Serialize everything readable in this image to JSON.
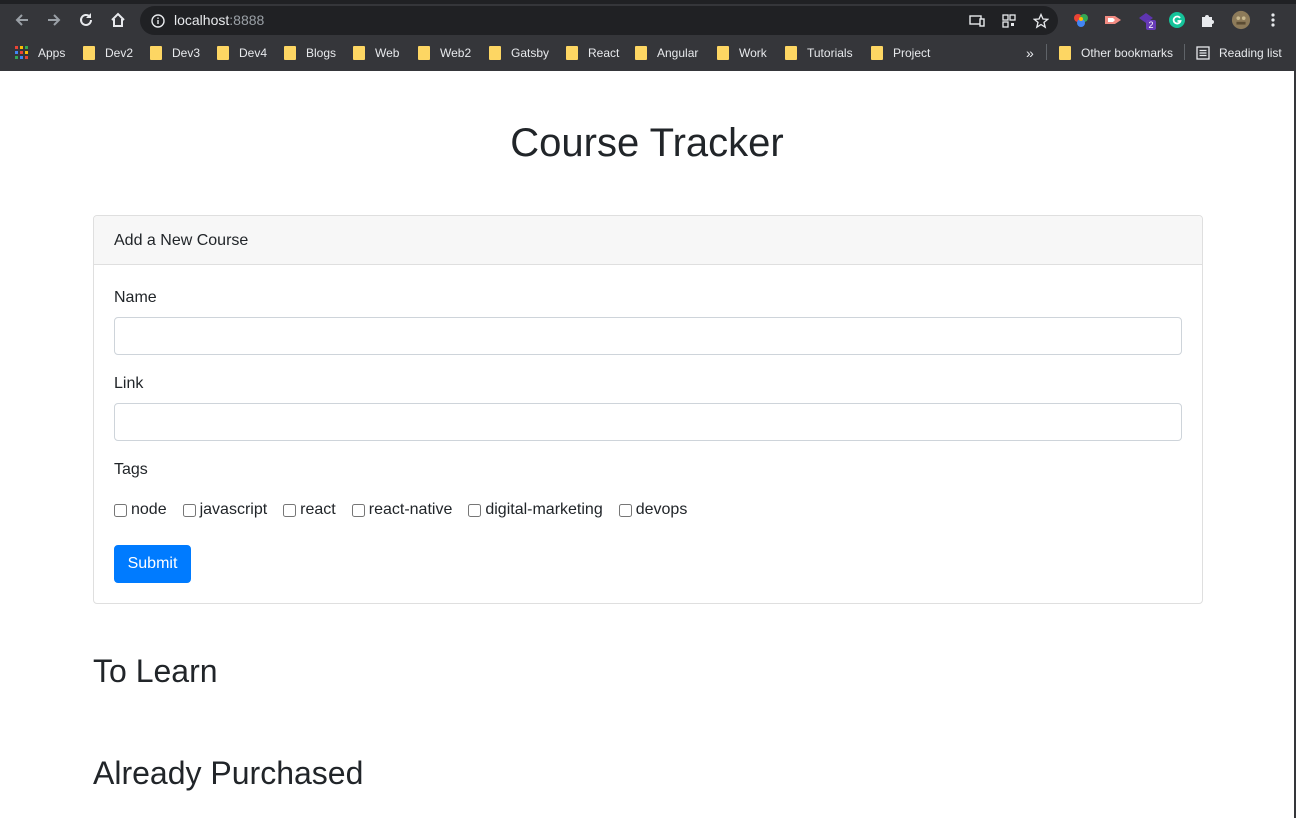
{
  "browser": {
    "url_host": "localhost",
    "url_port": ":8888",
    "extension_badge": "2",
    "bookmarks": [
      {
        "label": "Apps"
      },
      {
        "label": "Dev2"
      },
      {
        "label": "Dev3"
      },
      {
        "label": "Dev4"
      },
      {
        "label": "Blogs"
      },
      {
        "label": "Web"
      },
      {
        "label": "Web2"
      },
      {
        "label": "Gatsby"
      },
      {
        "label": "React"
      },
      {
        "label": "Angular"
      },
      {
        "label": "Work"
      },
      {
        "label": "Tutorials"
      },
      {
        "label": "Project"
      }
    ],
    "overflow_label": "»",
    "other_bookmarks": "Other bookmarks",
    "reading_list": "Reading list"
  },
  "page": {
    "title": "Course Tracker",
    "card": {
      "header": "Add a New Course",
      "name_label": "Name",
      "name_value": "",
      "link_label": "Link",
      "link_value": "",
      "tags_label": "Tags",
      "tags": [
        "node",
        "javascript",
        "react",
        "react-native",
        "digital-marketing",
        "devops"
      ],
      "submit_label": "Submit"
    },
    "to_learn_title": "To Learn",
    "purchased_title": "Already Purchased"
  },
  "colors": {
    "chrome_bg": "#35363a",
    "omnibox_bg": "#202124",
    "folder": "#fdd663",
    "primary": "#007bff",
    "text": "#212529"
  }
}
